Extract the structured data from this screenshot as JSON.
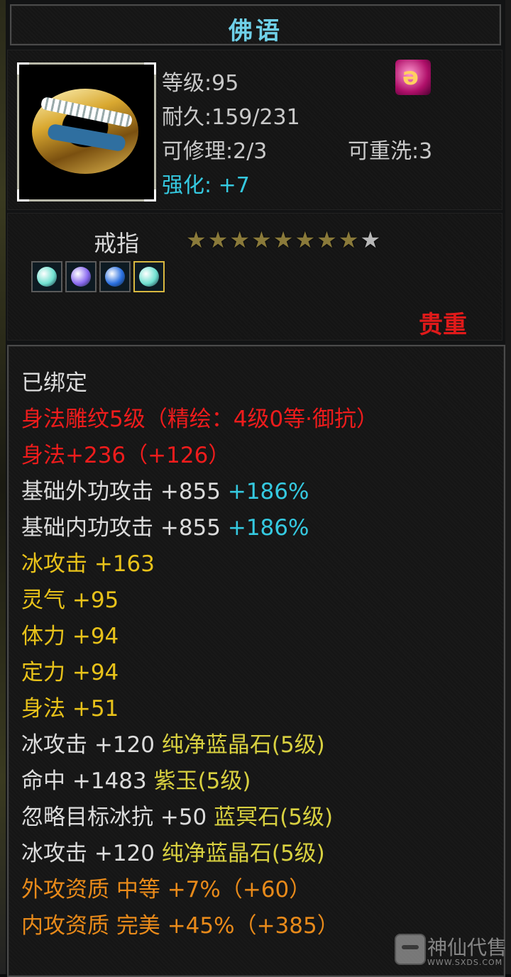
{
  "title": "佛语",
  "item": {
    "level": "等级:95",
    "durability": "耐久:159/231",
    "repairable": "可修理:2/3",
    "rewashable": "可重洗:3",
    "enhance": "强化: +7",
    "type": "戒指",
    "rarity": "贵重",
    "stars_total": 9,
    "stars_filled": 8
  },
  "attributes": [
    {
      "segments": [
        {
          "text": "已绑定",
          "color": "white"
        }
      ]
    },
    {
      "segments": [
        {
          "text": "身法雕纹5级（精绘：4级0等·御抗）",
          "color": "red"
        }
      ]
    },
    {
      "segments": [
        {
          "text": "身法+236（+126）",
          "color": "red"
        }
      ]
    },
    {
      "segments": [
        {
          "text": "基础外功攻击 +855 ",
          "color": "white"
        },
        {
          "text": "+186%",
          "color": "cyan"
        }
      ]
    },
    {
      "segments": [
        {
          "text": "基础内功攻击 +855 ",
          "color": "white"
        },
        {
          "text": "+186%",
          "color": "cyan"
        }
      ]
    },
    {
      "segments": [
        {
          "text": "冰攻击 +163",
          "color": "yellow"
        }
      ]
    },
    {
      "segments": [
        {
          "text": "灵气 +95",
          "color": "yellow"
        }
      ]
    },
    {
      "segments": [
        {
          "text": "体力 +94",
          "color": "yellow"
        }
      ]
    },
    {
      "segments": [
        {
          "text": "定力 +94",
          "color": "yellow"
        }
      ]
    },
    {
      "segments": [
        {
          "text": "身法 +51",
          "color": "yellow"
        }
      ]
    },
    {
      "segments": [
        {
          "text": "冰攻击 +120 ",
          "color": "white"
        },
        {
          "text": "纯净蓝晶石(5级)",
          "color": "lightyellow"
        }
      ]
    },
    {
      "segments": [
        {
          "text": "命中 +1483 ",
          "color": "white"
        },
        {
          "text": "紫玉(5级)",
          "color": "lightyellow"
        }
      ]
    },
    {
      "segments": [
        {
          "text": "忽略目标冰抗 +50 ",
          "color": "white"
        },
        {
          "text": "蓝冥石(5级)",
          "color": "lightyellow"
        }
      ]
    },
    {
      "segments": [
        {
          "text": "冰攻击 +120 ",
          "color": "white"
        },
        {
          "text": "纯净蓝晶石(5级)",
          "color": "lightyellow"
        }
      ]
    },
    {
      "segments": [
        {
          "text": "外攻资质  中等 +7%（+60）",
          "color": "orange"
        }
      ]
    },
    {
      "segments": [
        {
          "text": "内攻资质  完美 +45%（+385）",
          "color": "orange"
        }
      ]
    }
  ],
  "gems": [
    {
      "name": "gem-cyan-icon",
      "color": "#6fe0d0",
      "selected": false
    },
    {
      "name": "gem-purple-icon",
      "color": "#8a6af0",
      "selected": false
    },
    {
      "name": "gem-blue-icon",
      "color": "#2a70e0",
      "selected": false
    },
    {
      "name": "gem-cyan-icon",
      "color": "#6fe0d0",
      "selected": true
    }
  ],
  "watermark": {
    "name": "神仙代售",
    "url": "WWW.SXDS.COM"
  }
}
